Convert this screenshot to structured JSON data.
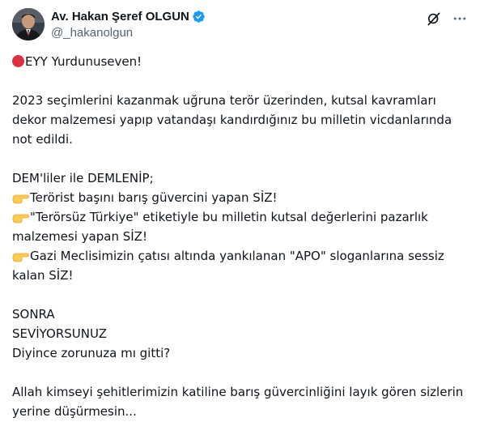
{
  "author": {
    "display_name": "Av. Hakan Şeref OLGUN",
    "handle": "@_hakanolgun",
    "verified_color": "#1d9bf0"
  },
  "icons": {
    "verified": "verified-badge-icon",
    "grok": "grok-icon",
    "more": "more-dots-icon",
    "alert": "red-circle-emoji",
    "pointer": "backhand-index-pointing-right-emoji"
  },
  "post": {
    "greeting": "EYY Yurdunuseven!",
    "paragraph1": "2023 seçimlerini kazanmak uğruna terör üzerinden, kutsal kavramları dekor malzemesi yapıp vatandaşı kandırdığınız bu milletin vicdanlarında not edildi.",
    "intro": "DEM'liler ile DEMLENİP;",
    "bullets": [
      "Terörist başını barış güvercini yapan SİZ!",
      "\"Terörsüz Türkiye\" etiketiyle bu milletin kutsal değerlerini pazarlık malzemesi yapan SİZ!",
      "Gazi Meclisimizin çatısı altında yankılanan \"APO\" sloganlarına sessiz kalan SİZ!"
    ],
    "closing_lines": [
      "SONRA",
      "SEVİYORSUNUZ",
      "Diyince zorunuza mı gitti?"
    ],
    "final": "Allah kimseyi şehitlerimizin katiline barış güvercinliğini layık gören sizlerin yerine düşürmesin..."
  }
}
